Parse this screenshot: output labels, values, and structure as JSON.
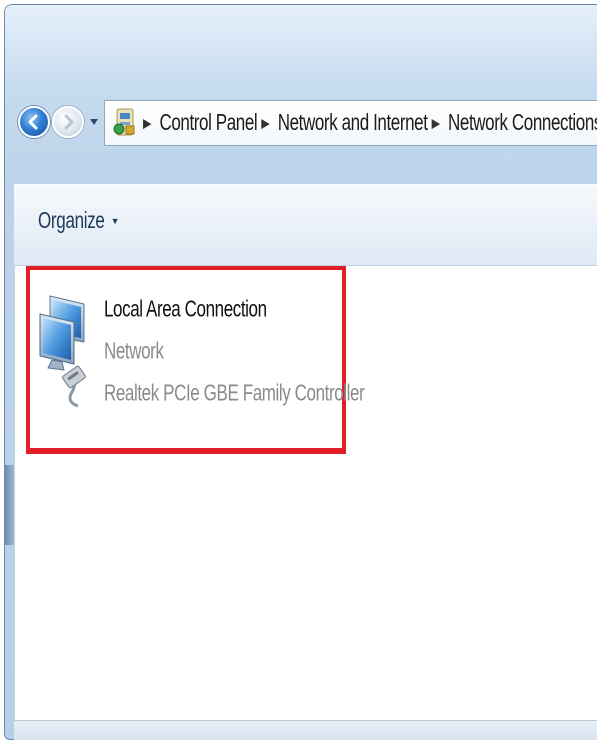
{
  "window": {
    "navigation": {
      "breadcrumbs": [
        "Control Panel",
        "Network and Internet",
        "Network Connections"
      ]
    },
    "toolbar": {
      "organize_label": "Organize",
      "organize_arrow": "▼"
    },
    "connections": [
      {
        "name": "Local Area Connection",
        "status": "Network",
        "adapter": "Realtek PCIe GBE Family Controller",
        "icon": "network-adapter-icon",
        "selected": true
      }
    ]
  },
  "colors": {
    "selection_highlight": "#e21f26",
    "window_frame": "#c9dcee",
    "toolbar_text": "#1e395b"
  }
}
